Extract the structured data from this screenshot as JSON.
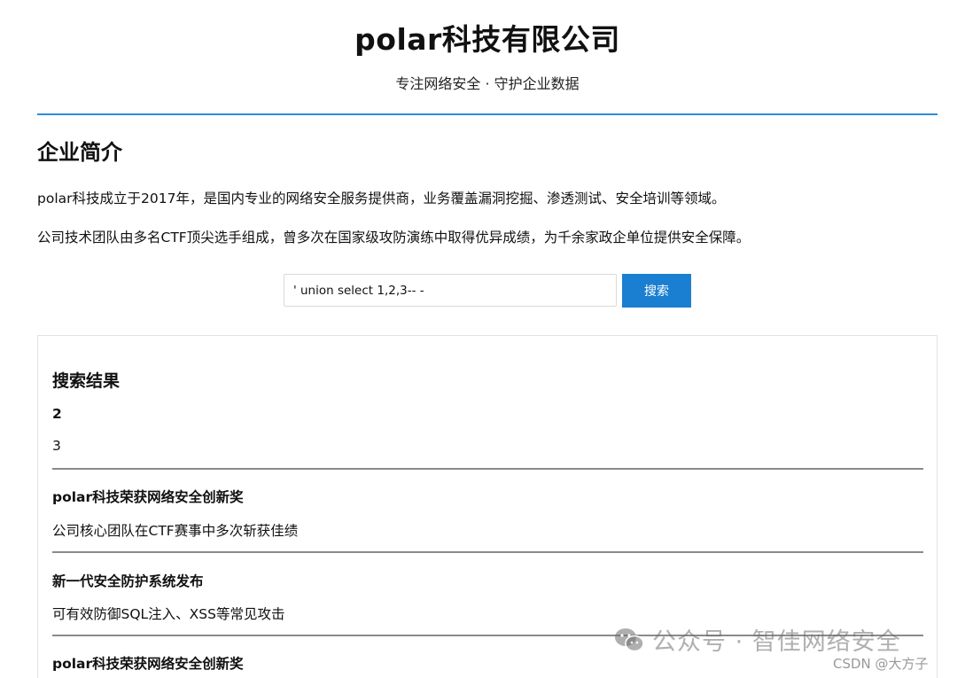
{
  "header": {
    "title": "polar科技有限公司",
    "tagline": "专注网络安全 · 守护企业数据"
  },
  "intro": {
    "heading": "企业简介",
    "paragraphs": [
      "polar科技成立于2017年，是国内专业的网络安全服务提供商，业务覆盖漏洞挖掘、渗透测试、安全培训等领域。",
      "公司技术团队由多名CTF顶尖选手组成，曾多次在国家级攻防演练中取得优异成绩，为千余家政企单位提供安全保障。"
    ]
  },
  "search": {
    "value": "' union select 1,2,3-- -",
    "button_label": "搜索"
  },
  "results": {
    "title": "搜索结果",
    "items": [
      {
        "title": "2",
        "desc": "3"
      },
      {
        "title": "polar科技荣获网络安全创新奖",
        "desc": "公司核心团队在CTF赛事中多次斩获佳绩"
      },
      {
        "title": "新一代安全防护系统发布",
        "desc": "可有效防御SQL注入、XSS等常见攻击"
      },
      {
        "title": "polar科技荣获网络安全创新奖",
        "desc": ""
      }
    ]
  },
  "watermarks": {
    "wechat": "公众号 · 智佳网络安全",
    "csdn": "CSDN @大方子"
  },
  "colors": {
    "accent": "#1a7fd0",
    "header_rule": "#2b8fd6",
    "divider": "#8a8a8a"
  }
}
